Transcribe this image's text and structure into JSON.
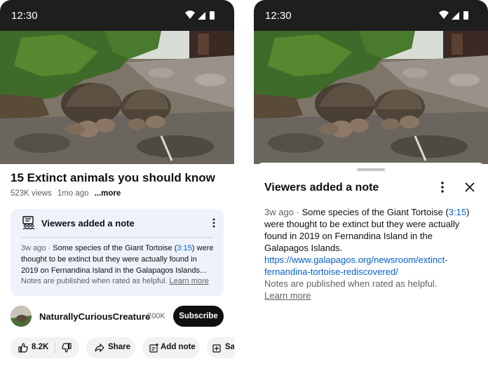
{
  "status_bar": {
    "time": "12:30"
  },
  "video": {
    "title": "15 Extinct animals you should know",
    "views": "523K views",
    "age": "1mo ago",
    "more_label": "...more"
  },
  "note_card": {
    "title": "Viewers added a note",
    "age": "3w ago",
    "separator": " · ",
    "text_before": "Some species of the Giant Tortoise (",
    "timestamp_link": "3:15",
    "text_after": ") were thought to be extinct but they were actually found in 2019 on Fernandina Island in the Galapagos Islands...",
    "footer_text": "Notes are published when rated as helpful.",
    "learn_more": "Learn more"
  },
  "channel": {
    "name": "NaturallyCuriousCreature",
    "subscribers": "200K",
    "subscribe_label": "Subscribe"
  },
  "actions": {
    "likes": "8.2K",
    "share_label": "Share",
    "add_note_label": "Add note",
    "save_label": "Sa"
  },
  "sheet": {
    "title": "Viewers added a note",
    "age": "3w ago",
    "separator": " · ",
    "text_before": "Some species of the Giant Tortoise (",
    "timestamp_link": "3:15",
    "text_after": ") were thought to be extinct but they were actually found in 2019 on Fernandina Island in the Galapagos Islands. ",
    "url": "https://www.galapagos.org/newsroom/extinct-fernandina-tortoise-rediscovered/",
    "footer_text": "Notes are published when rated as helpful.",
    "learn_more": "Learn more"
  },
  "colors": {
    "link": "#065fd4",
    "note_bg": "#eef3fb",
    "subscribe_bg": "#0f0f0f",
    "pill_bg": "#f2f2f2"
  },
  "icons": [
    "wifi-icon",
    "signal-icon",
    "battery-icon",
    "note-icon",
    "more-vert-icon",
    "like-icon",
    "dislike-icon",
    "share-icon",
    "add-note-icon",
    "save-icon",
    "close-icon"
  ]
}
